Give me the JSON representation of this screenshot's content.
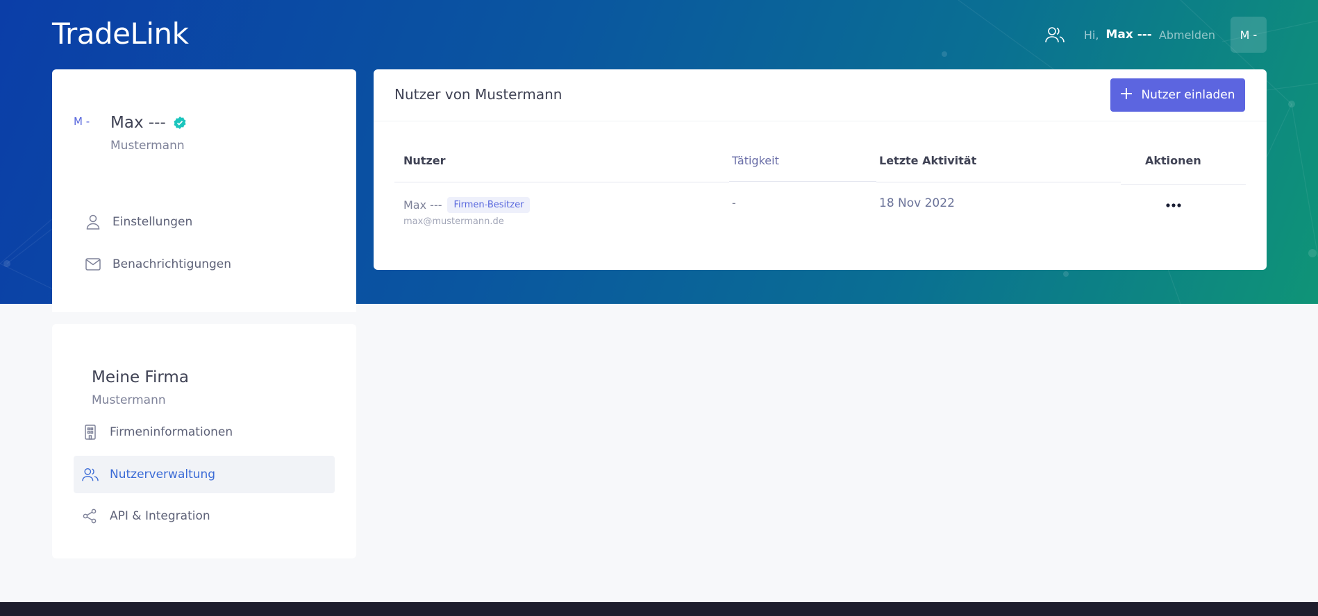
{
  "app": {
    "logo": "TradeLink"
  },
  "topbar": {
    "greeting": "Hi,",
    "user_name": "Max ---",
    "logout_label": "Abmelden",
    "avatar_initials": "M -",
    "icons": {
      "users": "users-icon"
    }
  },
  "profile": {
    "avatar_initials": "M -",
    "name": "Max ---",
    "company": "Mustermann",
    "verified_icon": "verified-icon",
    "nav": [
      {
        "label": "Einstellungen",
        "icon": "user-icon"
      },
      {
        "label": "Benachrichtigungen",
        "icon": "envelope-icon"
      }
    ]
  },
  "company": {
    "title": "Meine Firma",
    "name": "Mustermann",
    "nav": [
      {
        "label": "Firmeninformationen",
        "icon": "building-icon",
        "active": false
      },
      {
        "label": "Nutzerverwaltung",
        "icon": "users-icon",
        "active": true
      },
      {
        "label": "API & Integration",
        "icon": "share-nodes-icon",
        "active": false
      }
    ]
  },
  "main": {
    "title": "Nutzer von Mustermann",
    "invite_label": "Nutzer einladen",
    "table": {
      "headers": [
        "Nutzer",
        "Tätigkeit",
        "Letzte Aktivität",
        "Aktionen"
      ],
      "rows": [
        {
          "name": "Max ---",
          "badge": "Firmen-Besitzer",
          "email": "max@mustermann.de",
          "activity": "-",
          "last_activity": "18 Nov 2022",
          "actions_icon": "more-horizontal-icon"
        }
      ]
    }
  },
  "colors": {
    "primary": "#5c65e0",
    "hero_start": "#0b3ea8",
    "hero_end": "#0f9477",
    "active_link": "#3b6bd6",
    "verified": "#1bc5bd",
    "footer": "#1e1e2d"
  }
}
